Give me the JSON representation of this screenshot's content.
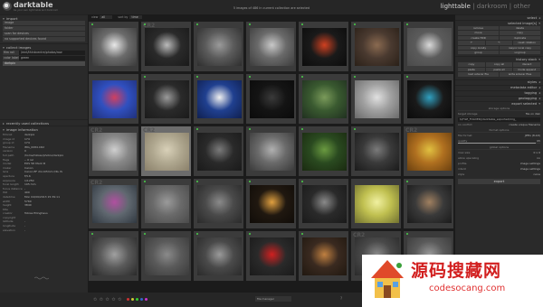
{
  "app": {
    "brand": "darktable",
    "brand_sub": "be your own light table and darkroom",
    "status": "5 images of 486 in current collection are selected",
    "views": {
      "active": "lighttable",
      "sep1": " | ",
      "v2": "darkroom",
      "sep2": " | ",
      "v3": "other"
    }
  },
  "left": {
    "import": {
      "title": "import",
      "buttons": [
        "image",
        "folder",
        "scan for devices",
        "no supported devices found"
      ]
    },
    "collect": {
      "title": "collect images",
      "rows": [
        {
          "k": "film roll",
          "v": "/mnt/thinkcentre/photos/raw"
        },
        {
          "k": "color label",
          "v": "green"
        }
      ],
      "active": "darkpix"
    },
    "recent": {
      "title": "recently used collections"
    },
    "info": {
      "title": "image information",
      "rows": [
        {
          "k": "filmroll",
          "v": "darkpix"
        },
        {
          "k": "image id",
          "v": "174"
        },
        {
          "k": "group id",
          "v": "174"
        },
        {
          "k": "filename",
          "v": "IMG_0084.CR2"
        },
        {
          "k": "version",
          "v": "0"
        },
        {
          "k": "full path",
          "v": "/home/tobias/photos/darkpix"
        },
        {
          "k": "flags",
          "v": "-- 0 rel"
        },
        {
          "k": "model",
          "v": "EOS 5D Mark III"
        },
        {
          "k": "maker",
          "v": "Canon"
        },
        {
          "k": "lens",
          "v": "Canon EF 24-105mm f/4L IS"
        },
        {
          "k": "aperture",
          "v": "f/5.6"
        },
        {
          "k": "exposure",
          "v": "1/1250"
        },
        {
          "k": "focal length",
          "v": "105 mm"
        },
        {
          "k": "focus distance",
          "v": "-"
        },
        {
          "k": "ISO",
          "v": "400"
        },
        {
          "k": "datetime",
          "v": "Mon 04/09/2013 15:39:11"
        },
        {
          "k": "width",
          "v": "5760"
        },
        {
          "k": "height",
          "v": "3840"
        },
        {
          "k": "title",
          "v": ""
        },
        {
          "k": "creator",
          "v": "Tobias Ellinghaus"
        },
        {
          "k": "copyright",
          "v": ""
        },
        {
          "k": "latitude",
          "v": "-"
        },
        {
          "k": "longitude",
          "v": "-"
        },
        {
          "k": "elevation",
          "v": "-"
        }
      ]
    }
  },
  "center": {
    "toolbar": {
      "view_label": "view",
      "view_value": "all",
      "sort_label": "sort by",
      "sort_value": "time"
    },
    "cells": [
      {
        "ext": "",
        "c1": "#6b6b6b",
        "c2": "#e8e8e8",
        "c3": "#3a3a3a",
        "sel": false,
        "dot": true
      },
      {
        "ext": "CR2",
        "c1": "#2a2a2a",
        "c2": "#bbbbbb",
        "c3": "#1a1a1a",
        "sel": false,
        "dot": true
      },
      {
        "ext": "",
        "c1": "#5b5b5b",
        "c2": "#9a9a9a",
        "c3": "#2e2e2e",
        "sel": false,
        "dot": true
      },
      {
        "ext": "",
        "c1": "#6a6a6a",
        "c2": "#c8c8c8",
        "c3": "#3c3c3c",
        "sel": false,
        "dot": true
      },
      {
        "ext": "",
        "c1": "#1a1a1a",
        "c2": "#d04020",
        "c3": "#0c0c0c",
        "sel": false,
        "dot": true
      },
      {
        "ext": "",
        "c1": "#4a3a30",
        "c2": "#8a6a50",
        "c3": "#2a2018",
        "sel": false,
        "dot": true
      },
      {
        "ext": "",
        "c1": "#5b5b5b",
        "c2": "#d9d9d9",
        "c3": "#4a4a4a",
        "sel": false,
        "dot": true
      },
      {
        "ext": "",
        "c1": "#3050c0",
        "c2": "#d04060",
        "c3": "#20307a",
        "sel": false,
        "dot": false
      },
      {
        "ext": "",
        "c1": "#2a2a2a",
        "c2": "#9a9a9a",
        "c3": "#1a1a1a",
        "sel": false,
        "dot": true
      },
      {
        "ext": "",
        "c1": "#204090",
        "c2": "#f0f0f0",
        "c3": "#102050",
        "sel": false,
        "dot": true
      },
      {
        "ext": "",
        "c1": "#141414",
        "c2": "#3a3a3a",
        "c3": "#0a0a0a",
        "sel": false,
        "dot": true
      },
      {
        "ext": "",
        "c1": "#3a5a30",
        "c2": "#7a9a5a",
        "c3": "#203020",
        "sel": false,
        "dot": true
      },
      {
        "ext": "",
        "c1": "#a0a0a0",
        "c2": "#e0e0e0",
        "c3": "#6a6a6a",
        "sel": false,
        "dot": true
      },
      {
        "ext": "",
        "c1": "#1a1a1a",
        "c2": "#30a0c0",
        "c3": "#0a0a0a",
        "sel": false,
        "dot": true
      },
      {
        "ext": "CR2",
        "c1": "#888888",
        "c2": "#cfcfcf",
        "c3": "#5a5a5a",
        "sel": false,
        "dot": false
      },
      {
        "ext": "CR2",
        "c1": "#b0a890",
        "c2": "#d8d0b8",
        "c3": "#8a806a",
        "sel": true,
        "dot": false
      },
      {
        "ext": "",
        "c1": "#2a2a2a",
        "c2": "#7a7a7a",
        "c3": "#1a1a1a",
        "sel": false,
        "dot": true
      },
      {
        "ext": "",
        "c1": "#6a6a6a",
        "c2": "#b0b0b0",
        "c3": "#3a3a3a",
        "sel": false,
        "dot": true
      },
      {
        "ext": "",
        "c1": "#2a4a20",
        "c2": "#6a9a40",
        "c3": "#1a2a10",
        "sel": false,
        "dot": true
      },
      {
        "ext": "",
        "c1": "#3a3a3a",
        "c2": "#7a7a7a",
        "c3": "#1a1a1a",
        "sel": false,
        "dot": true
      },
      {
        "ext": "CR2",
        "c1": "#b07020",
        "c2": "#e0c040",
        "c3": "#6a4010",
        "sel": false,
        "dot": false
      },
      {
        "ext": "CR2",
        "c1": "#606870",
        "c2": "#b050a0",
        "c3": "#303840",
        "sel": false,
        "dot": false
      },
      {
        "ext": "",
        "c1": "#6a6a6a",
        "c2": "#9a9a9a",
        "c3": "#4a4a4a",
        "sel": false,
        "dot": true
      },
      {
        "ext": "",
        "c1": "#4a4a4a",
        "c2": "#8a8a8a",
        "c3": "#2a2a2a",
        "sel": false,
        "dot": true
      },
      {
        "ext": "",
        "c1": "#201810",
        "c2": "#e0a040",
        "c3": "#100c08",
        "sel": false,
        "dot": true
      },
      {
        "ext": "",
        "c1": "#2a2a2a",
        "c2": "#8a8a8a",
        "c3": "#1a1a1a",
        "sel": false,
        "dot": true
      },
      {
        "ext": "",
        "c1": "#c0c050",
        "c2": "#f0f0a0",
        "c3": "#707030",
        "sel": false,
        "dot": false
      },
      {
        "ext": "",
        "c1": "#3a3a3a",
        "c2": "#a08060",
        "c3": "#1a1a1a",
        "sel": false,
        "dot": true
      },
      {
        "ext": "",
        "c1": "#5a5a5a",
        "c2": "#a0a0a0",
        "c3": "#2a2a2a",
        "sel": false,
        "dot": true
      },
      {
        "ext": "",
        "c1": "#5a5a5a",
        "c2": "#8a8a8a",
        "c3": "#3a3a3a",
        "sel": false,
        "dot": true
      },
      {
        "ext": "",
        "c1": "#4a4a4a",
        "c2": "#9a9a9a",
        "c3": "#2a2a2a",
        "sel": false,
        "dot": true
      },
      {
        "ext": "",
        "c1": "#2a2a2a",
        "c2": "#d02020",
        "c3": "#1a1a1a",
        "sel": false,
        "dot": true
      },
      {
        "ext": "",
        "c1": "#3a2a20",
        "c2": "#c08040",
        "c3": "#201810",
        "sel": false,
        "dot": true
      },
      {
        "ext": "CR2",
        "c1": "#4a4a4a",
        "c2": "#8a8a8a",
        "c3": "#2a2a2a",
        "sel": false,
        "dot": false
      },
      {
        "ext": "",
        "c1": "#5a5a5a",
        "c2": "#9a9a9a",
        "c3": "#3a3a3a",
        "sel": false,
        "dot": true
      }
    ]
  },
  "right": {
    "select": {
      "title": "select"
    },
    "selected": {
      "title": "selected image[s]",
      "buttons": [
        "remove",
        "delete",
        "move",
        "copy",
        "create HDR",
        "duplicate",
        "↶",
        "↷",
        "reset rotation",
        "copy locally",
        "resync local copy",
        "group",
        "ungroup"
      ]
    },
    "history": {
      "title": "history stack",
      "buttons": [
        "copy",
        "copy all",
        "discard",
        "paste",
        "paste all",
        "mode",
        "append",
        "load sidecar file",
        "write sidecar files"
      ]
    },
    "styles": {
      "title": "styles"
    },
    "metadata": {
      "title": "metadata editor"
    },
    "tagging": {
      "title": "tagging"
    },
    "geotagging": {
      "title": "geotagging"
    },
    "export": {
      "title": "export selected",
      "storage_title": "storage options",
      "target_label": "target storage",
      "target_value": "file on disk",
      "path": "$(FILE_FOLDER)/darktable_exported/img_",
      "conflict_label": "on conflict",
      "conflict_value": "create unique filename",
      "format_title": "format options",
      "format_label": "file format",
      "format_value": "JPEG (8-bit)",
      "quality_label": "quality",
      "quality_value": "95",
      "global_title": "global options",
      "maxsize_label": "max size",
      "maxsize_w": "0",
      "maxsize_x": "x",
      "maxsize_h": "0",
      "upscale_label": "allow upscaling",
      "upscale_value": "no",
      "profile_label": "profile",
      "profile_value": "image settings",
      "intent_label": "intent",
      "intent_value": "image settings",
      "style_label": "style",
      "style_value": "none",
      "export_button": "export",
      "quality_fraction": 0.95
    }
  },
  "bottom": {
    "stars": "✩ ✩ ✩ ✩ ✩",
    "label_colors": [
      "#cc3333",
      "#cccc33",
      "#33cc33",
      "#3366cc",
      "#cc33cc"
    ],
    "film_mode": "file manager",
    "help": "?"
  },
  "watermark": {
    "title": "源码搜藏网",
    "url": "codesocang.com"
  }
}
